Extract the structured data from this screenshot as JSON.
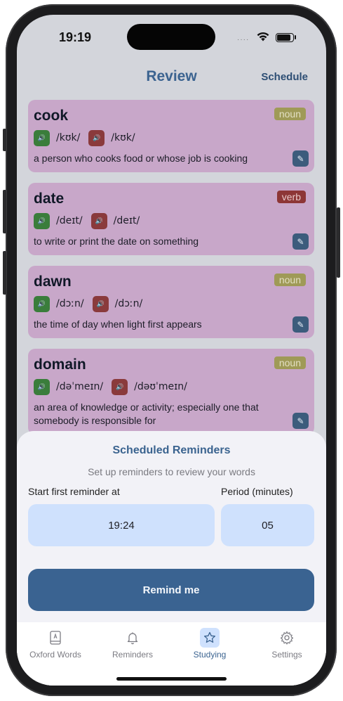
{
  "status_bar": {
    "time": "19:19",
    "signal_dots": "····"
  },
  "header": {
    "title": "Review",
    "schedule_label": "Schedule"
  },
  "cards": [
    {
      "word": "cook",
      "pos": "noun",
      "ipa_uk": "/kʊk/",
      "ipa_us": "/kʊk/",
      "definition": "a person who cooks food or whose job is cooking"
    },
    {
      "word": "date",
      "pos": "verb",
      "ipa_uk": "/deɪt/",
      "ipa_us": "/deɪt/",
      "definition": "to write or print the date on something"
    },
    {
      "word": "dawn",
      "pos": "noun",
      "ipa_uk": "/dɔːn/",
      "ipa_us": "/dɔːn/",
      "definition": "the time of day when light first appears"
    },
    {
      "word": "domain",
      "pos": "noun",
      "ipa_uk": "/dəˈmeɪn/",
      "ipa_us": "/dəʊˈmeɪn/",
      "definition": "an area of knowledge or activity; especially one that somebody is responsible for"
    }
  ],
  "sheet": {
    "title": "Scheduled Reminders",
    "subtitle": "Set up reminders to review your words",
    "start_label": "Start first reminder at",
    "period_label": "Period (minutes)",
    "start_value": "19:24",
    "period_value": "05",
    "button_label": "Remind me"
  },
  "tabs": [
    {
      "label": "Oxford Words",
      "icon": "book-icon",
      "active": false
    },
    {
      "label": "Reminders",
      "icon": "bell-icon",
      "active": false
    },
    {
      "label": "Studying",
      "icon": "star-icon",
      "active": true
    },
    {
      "label": "Settings",
      "icon": "gear-icon",
      "active": false
    }
  ],
  "colors": {
    "accent": "#3b6390",
    "field_bg": "#cfe1fd",
    "noun_badge": "#9f9a57",
    "verb_badge": "#8d3636",
    "uk_speaker": "#3a7d3b",
    "us_speaker": "#8a3a3c"
  }
}
